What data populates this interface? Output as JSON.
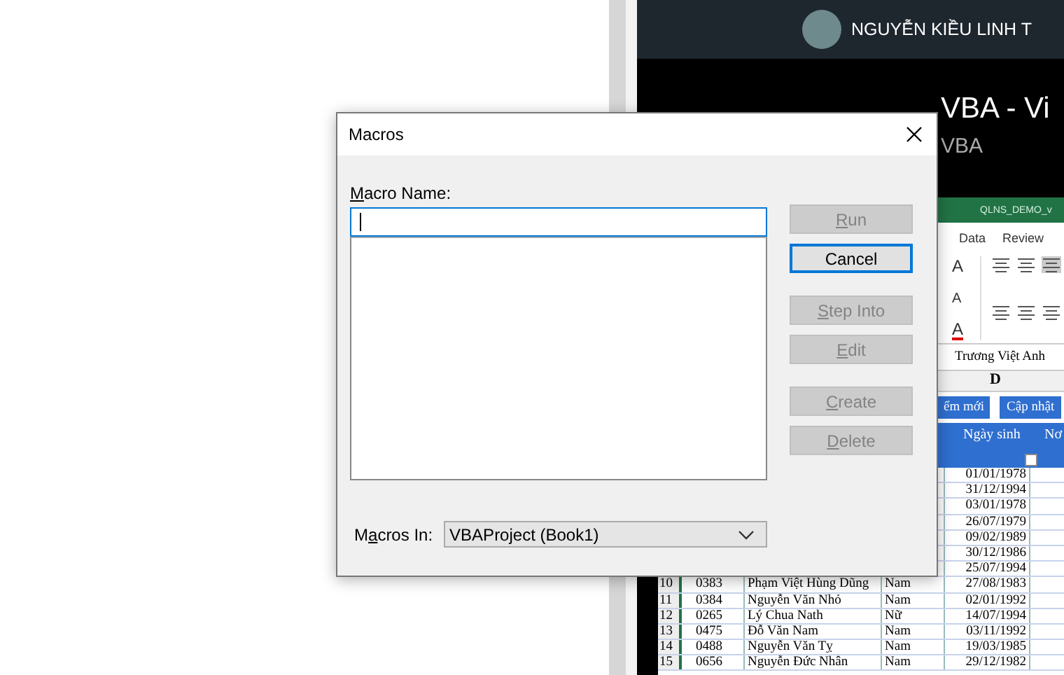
{
  "video": {
    "author": "NGUYỄN KIỀU LINH T",
    "title": "VBA - Vi",
    "subtitle": "VBA",
    "excel": {
      "file_title": "QLNS_DEMO_v",
      "ribbon_tabs": [
        {
          "label": "Data"
        },
        {
          "label": "Review"
        }
      ],
      "font_buttons": [
        "A",
        "A",
        "A"
      ],
      "formula": "Trương Việt Anh",
      "column_header": "D",
      "sheet_buttons": [
        "ểm mới",
        "Cập nhật"
      ],
      "table_headers": [
        "Ngày sinh",
        "Nơ"
      ],
      "rows": [
        {
          "date": "01/01/1978"
        },
        {
          "date": "31/12/1994"
        },
        {
          "date": "03/01/1978"
        },
        {
          "date": "26/07/1979"
        },
        {
          "date": "09/02/1989"
        },
        {
          "date": "30/12/1986"
        },
        {
          "date": "25/07/1994"
        },
        {
          "row_number": "10",
          "id": "0383",
          "name": "Phạm Việt Hùng Dũng",
          "gender": "Nam",
          "date": "27/08/1983"
        },
        {
          "row_number": "11",
          "id": "0384",
          "name": "Nguyễn Văn Nhỏ",
          "gender": "Nam",
          "date": "02/01/1992"
        },
        {
          "row_number": "12",
          "id": "0265",
          "name": "Lý Chua Nath",
          "gender": "Nữ",
          "date": "14/07/1994"
        },
        {
          "row_number": "13",
          "id": "0475",
          "name": "Đỗ Văn Nam",
          "gender": "Nam",
          "date": "03/11/1992"
        },
        {
          "row_number": "14",
          "id": "0488",
          "name": "Nguyễn Văn Tỵ",
          "gender": "Nam",
          "date": "19/03/1985"
        },
        {
          "row_number": "15",
          "id": "0656",
          "name": "Nguyễn Đức Nhân",
          "gender": "Nam",
          "date": "29/12/1982"
        }
      ]
    }
  },
  "dialog": {
    "title": "Macros",
    "name_label": {
      "key": "M",
      "after": "acro Name:"
    },
    "button_groups": [
      [
        {
          "key": "R",
          "after": "un",
          "disabled": true,
          "focused": false
        },
        {
          "after": "Cancel",
          "disabled": false,
          "focused": true
        }
      ],
      [
        {
          "key": "S",
          "after": "tep Into",
          "disabled": true,
          "focused": false
        },
        {
          "key": "E",
          "after": "dit",
          "disabled": true,
          "focused": false
        }
      ],
      [
        {
          "key": "C",
          "after": "reate",
          "disabled": true,
          "focused": false
        },
        {
          "key": "D",
          "after": "elete",
          "disabled": true,
          "focused": false
        }
      ]
    ],
    "macros_in_label": {
      "before": "M",
      "key": "a",
      "after": "cros In:"
    },
    "macros_in_value": "VBAProject (Book1)"
  }
}
